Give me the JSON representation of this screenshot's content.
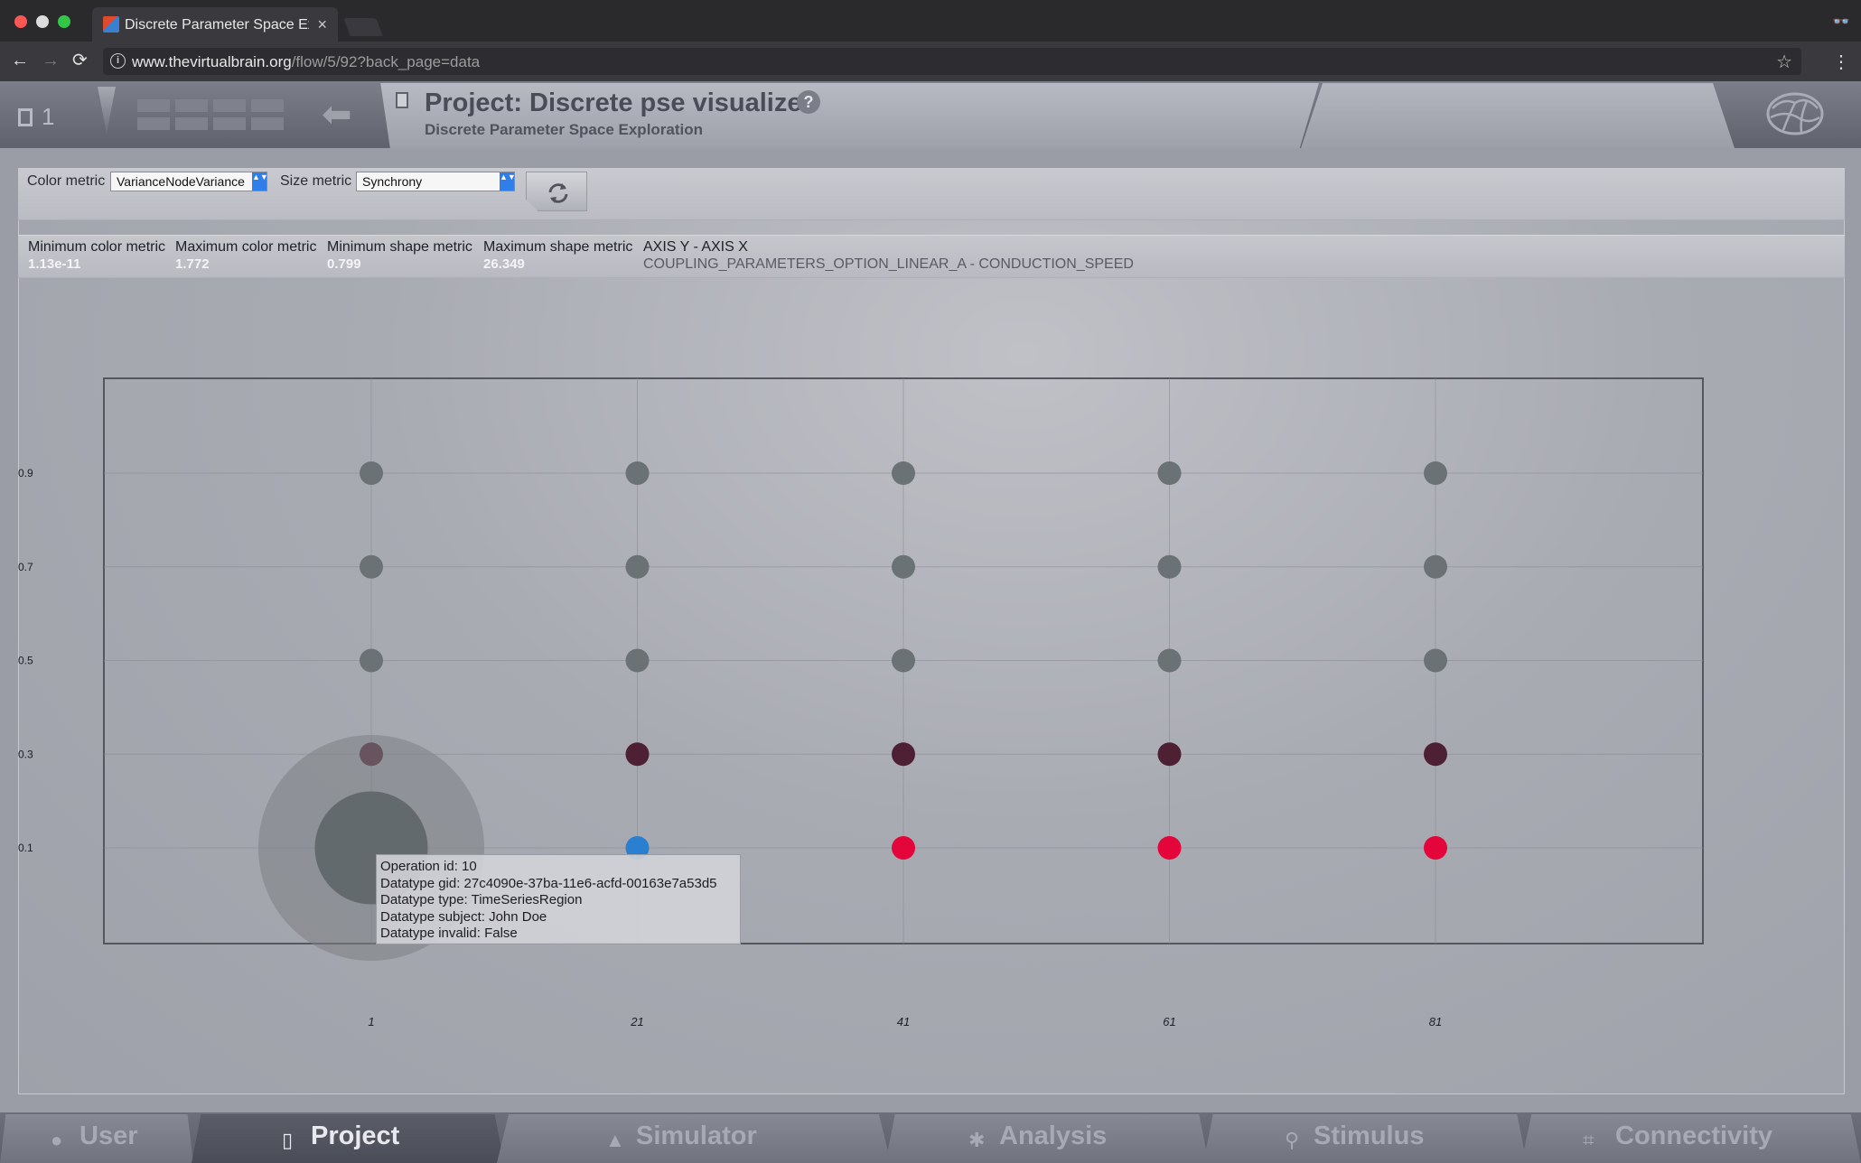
{
  "browser": {
    "tab_title": "Discrete Parameter Space Exp",
    "tab_close": "×",
    "url_host": "www.thevirtualbrain.org",
    "url_path": "/flow/5/92?back_page=data",
    "info_glyph": "i",
    "star_glyph": "☆",
    "menu_glyph": "⋮",
    "incognito_glyph": "👓",
    "back_glyph": "←",
    "forward_glyph": "→",
    "reload_glyph": "⟳"
  },
  "header": {
    "project_count": "1",
    "title": "Project: Discrete pse visualizer",
    "subtitle": "Discrete Parameter Space Exploration",
    "help_glyph": "?",
    "back_glyph": "⬅"
  },
  "controls": {
    "color_metric_label": "Color metric",
    "color_metric_value": "VarianceNodeVariance",
    "size_metric_label": "Size metric",
    "size_metric_value": "Synchrony",
    "select_arrow": "▲▼"
  },
  "metrics": {
    "min_color_label": "Minimum color metric",
    "min_color_value": "1.13e-11",
    "max_color_label": "Maximum color metric",
    "max_color_value": "1.772",
    "min_shape_label": "Minimum shape metric",
    "min_shape_value": "0.799",
    "max_shape_label": "Maximum shape metric",
    "max_shape_value": "26.349",
    "axis_label": "AXIS Y - AXIS X",
    "axis_params": "COUPLING_PARAMETERS_OPTION_LINEAR_A - CONDUCTION_SPEED"
  },
  "colors": {
    "gray_point": "#6a7276",
    "dark_point": "#4e2034",
    "red_point": "#e4063a",
    "blue_point": "#2b7fd0",
    "selected_inner": "#5e6668",
    "selected_outer": "#7b8083"
  },
  "chart_data": {
    "type": "scatter",
    "x_ticks": [
      "1",
      "21",
      "41",
      "61",
      "81"
    ],
    "y_ticks": [
      "0.9",
      "0.7",
      "0.5",
      "0.3",
      "0.1"
    ],
    "x_values": [
      1,
      21,
      41,
      61,
      81
    ],
    "y_values": [
      0.9,
      0.7,
      0.5,
      0.3,
      0.1
    ],
    "points": [
      {
        "x": 1,
        "y": 0.9,
        "color": "gray",
        "size": 1
      },
      {
        "x": 21,
        "y": 0.9,
        "color": "gray",
        "size": 1
      },
      {
        "x": 41,
        "y": 0.9,
        "color": "gray",
        "size": 1
      },
      {
        "x": 61,
        "y": 0.9,
        "color": "gray",
        "size": 1
      },
      {
        "x": 81,
        "y": 0.9,
        "color": "gray",
        "size": 1
      },
      {
        "x": 1,
        "y": 0.7,
        "color": "gray",
        "size": 1
      },
      {
        "x": 21,
        "y": 0.7,
        "color": "gray",
        "size": 1
      },
      {
        "x": 41,
        "y": 0.7,
        "color": "gray",
        "size": 1
      },
      {
        "x": 61,
        "y": 0.7,
        "color": "gray",
        "size": 1
      },
      {
        "x": 81,
        "y": 0.7,
        "color": "gray",
        "size": 1
      },
      {
        "x": 1,
        "y": 0.5,
        "color": "gray",
        "size": 1
      },
      {
        "x": 21,
        "y": 0.5,
        "color": "gray",
        "size": 1
      },
      {
        "x": 41,
        "y": 0.5,
        "color": "gray",
        "size": 1
      },
      {
        "x": 61,
        "y": 0.5,
        "color": "gray",
        "size": 1
      },
      {
        "x": 81,
        "y": 0.5,
        "color": "gray",
        "size": 1
      },
      {
        "x": 1,
        "y": 0.3,
        "color": "dark",
        "size": 1
      },
      {
        "x": 21,
        "y": 0.3,
        "color": "dark",
        "size": 1
      },
      {
        "x": 41,
        "y": 0.3,
        "color": "dark",
        "size": 1
      },
      {
        "x": 61,
        "y": 0.3,
        "color": "dark",
        "size": 1
      },
      {
        "x": 81,
        "y": 0.3,
        "color": "dark",
        "size": 1
      },
      {
        "x": 1,
        "y": 0.1,
        "color": "gray",
        "size": 3.7,
        "selected": true
      },
      {
        "x": 21,
        "y": 0.1,
        "color": "blue",
        "size": 1
      },
      {
        "x": 41,
        "y": 0.1,
        "color": "red",
        "size": 1
      },
      {
        "x": 61,
        "y": 0.1,
        "color": "red",
        "size": 1
      },
      {
        "x": 81,
        "y": 0.1,
        "color": "red",
        "size": 1
      }
    ],
    "grid": true
  },
  "tooltip": {
    "line1": "Operation id: 10",
    "line2": "Datatype gid: 27c4090e-37ba-11e6-acfd-00163e7a53d5",
    "line3": "Datatype type: TimeSeriesRegion",
    "line4": "Datatype subject: John Doe",
    "line5": "Datatype invalid: False"
  },
  "bottom_nav": {
    "user": "User",
    "project": "Project",
    "simulator": "Simulator",
    "analysis": "Analysis",
    "stimulus": "Stimulus",
    "connectivity": "Connectivity"
  }
}
